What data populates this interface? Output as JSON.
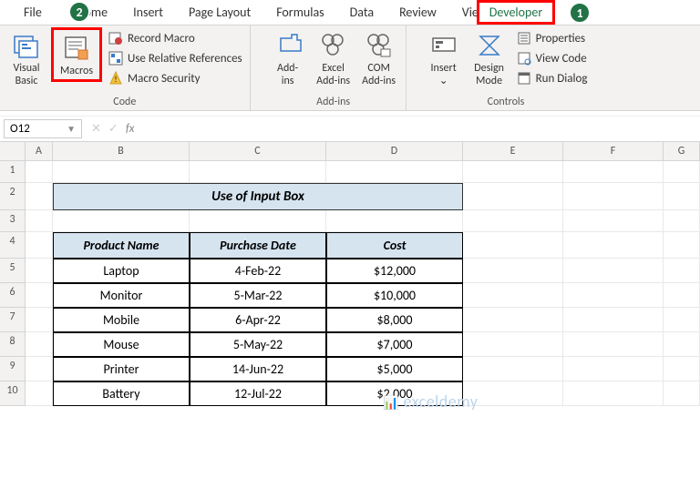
{
  "tabs": {
    "file": "File",
    "home": "Home",
    "insert": "Insert",
    "page_layout": "Page Layout",
    "formulas": "Formulas",
    "data": "Data",
    "review": "Review",
    "view": "View",
    "developer": "Developer"
  },
  "ribbon": {
    "code": {
      "visual_basic": "Visual\nBasic",
      "macros": "Macros",
      "record_macro": "Record Macro",
      "use_relative": "Use Relative References",
      "macro_security": "Macro Security",
      "label": "Code"
    },
    "addins": {
      "addins": "Add-\nins",
      "excel_addins": "Excel\nAdd-ins",
      "com_addins": "COM\nAdd-ins",
      "label": "Add-ins"
    },
    "controls": {
      "insert": "Insert",
      "design_mode": "Design\nMode",
      "properties": "Properties",
      "view_code": "View Code",
      "run_dialog": "Run Dialog",
      "label": "Controls"
    }
  },
  "badges": {
    "b1": "1",
    "b2": "2"
  },
  "namebox": "O12",
  "sheet": {
    "cols": [
      "A",
      "B",
      "C",
      "D",
      "E",
      "F",
      "G"
    ],
    "rows": [
      "1",
      "2",
      "3",
      "4",
      "5",
      "6",
      "7",
      "8",
      "9",
      "10"
    ],
    "title": "Use of Input Box",
    "headers": {
      "c1": "Product Name",
      "c2": "Purchase Date",
      "c3": "Cost"
    },
    "data": [
      {
        "name": "Laptop",
        "date": "4-Feb-22",
        "cost": "$12,000"
      },
      {
        "name": "Monitor",
        "date": "5-Mar-22",
        "cost": "$10,000"
      },
      {
        "name": "Mobile",
        "date": "6-Apr-22",
        "cost": "$8,000"
      },
      {
        "name": "Mouse",
        "date": "5-May-22",
        "cost": "$7,000"
      },
      {
        "name": "Printer",
        "date": "14-Jun-22",
        "cost": "$5,000"
      },
      {
        "name": "Battery",
        "date": "12-Jul-22",
        "cost": "$2,000"
      }
    ]
  },
  "watermark": "exceldemy"
}
